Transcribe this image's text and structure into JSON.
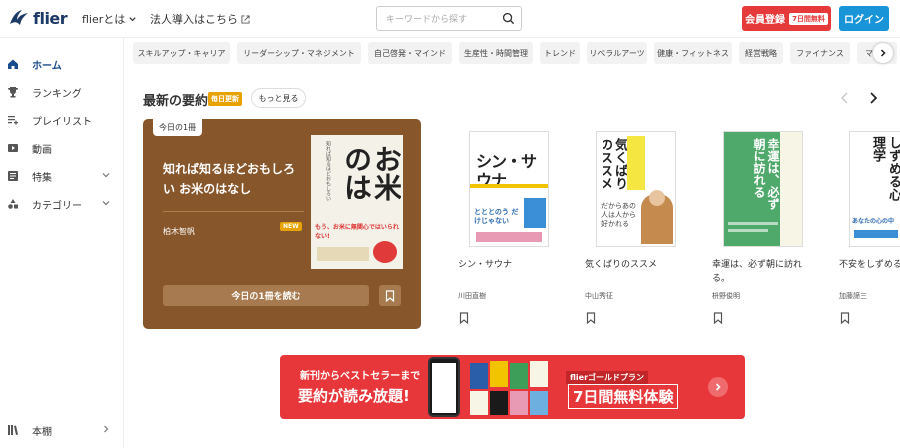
{
  "header": {
    "logo_text": "flier",
    "nav_about": "flierとは",
    "nav_corp": "法人導入はこちら",
    "search_placeholder": "キーワードから探す",
    "register_label": "会員登録",
    "register_badge": "7日間無料",
    "login_label": "ログイン",
    "brand_red": "#e6393a",
    "brand_blue": "#1a94d9"
  },
  "sidebar": {
    "items": [
      {
        "label": "ホーム",
        "icon": "home-icon"
      },
      {
        "label": "ランキング",
        "icon": "trophy-icon"
      },
      {
        "label": "プレイリスト",
        "icon": "playlist-icon"
      },
      {
        "label": "動画",
        "icon": "video-icon"
      },
      {
        "label": "特集",
        "icon": "feature-icon"
      },
      {
        "label": "カテゴリー",
        "icon": "category-icon"
      }
    ],
    "bookshelf": "本棚"
  },
  "tags": [
    "スキルアップ・キャリア",
    "リーダーシップ・マネジメント",
    "自己啓発・マインド",
    "生産性・時間管理",
    "トレンド",
    "リベラルアーツ",
    "健康・フィットネス",
    "経営戦略",
    "ファイナンス",
    "マ"
  ],
  "section": {
    "title": "最新の要約",
    "daily_badge": "毎日更新",
    "more": "もっと見る"
  },
  "feature": {
    "badge": "今日の1冊",
    "title": "知れば知るほどおもしろい お米のはなし",
    "author": "柏木智帆",
    "new_badge": "NEW",
    "read_label": "今日の1冊を読む",
    "cover_title_main": "お米のはなし",
    "cover_title_top": "知れば知るほどおもしろい",
    "cover_tagline": "もう、お米に無関心ではいられない!"
  },
  "books": [
    {
      "title": "シン・サウナ",
      "author": "川田直樹",
      "cover_main": "シン・サウナ",
      "cover_sub": "とととのう だけじゃない"
    },
    {
      "title": "気くばりのススメ",
      "author": "中山秀征",
      "cover_main": "気くばりのススメ",
      "cover_sub": "だからあの人は人から好かれる"
    },
    {
      "title": "幸運は、必ず朝に訪れる。",
      "author": "枡野俊明",
      "cover_main": "幸運は、必ず朝に訪れる"
    },
    {
      "title": "不安をしずめる心理学",
      "author": "加藤諦三",
      "cover_main": "しずめる心理学",
      "cover_sub": "あなたの心の中"
    }
  ],
  "banner": {
    "line1": "新刊からベストセラーまで",
    "line2": "要約が読み放題!",
    "plan": "flierゴールドプラン",
    "trial": "7日間無料体験"
  }
}
